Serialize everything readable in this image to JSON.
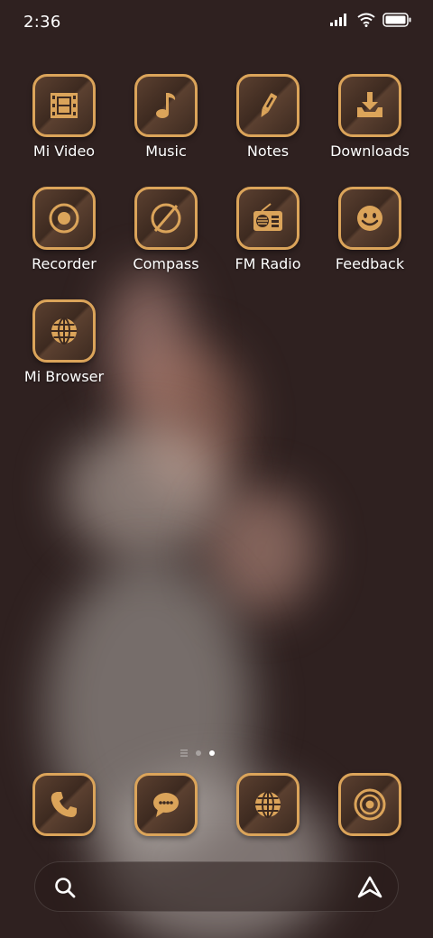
{
  "status_bar": {
    "time": "2:36",
    "icons": [
      "signal-icon",
      "wifi-icon",
      "battery-icon"
    ]
  },
  "home": {
    "apps": [
      {
        "label": "Mi Video",
        "icon": "film-icon"
      },
      {
        "label": "Music",
        "icon": "music-note-icon"
      },
      {
        "label": "Notes",
        "icon": "pen-icon"
      },
      {
        "label": "Downloads",
        "icon": "download-icon"
      },
      {
        "label": "Recorder",
        "icon": "record-icon"
      },
      {
        "label": "Compass",
        "icon": "compass-icon"
      },
      {
        "label": "FM Radio",
        "icon": "radio-icon"
      },
      {
        "label": "Feedback",
        "icon": "smiley-icon"
      },
      {
        "label": "Mi Browser",
        "icon": "globe-icon"
      }
    ],
    "page_indicator": {
      "pages": 2,
      "current": 2,
      "has_feed_page": true
    }
  },
  "dock": {
    "apps": [
      {
        "name": "Phone",
        "icon": "phone-icon"
      },
      {
        "name": "Messages",
        "icon": "chat-icon"
      },
      {
        "name": "Browser",
        "icon": "globe-icon"
      },
      {
        "name": "Camera",
        "icon": "lens-icon"
      }
    ]
  },
  "search_bar": {
    "left_icon": "search-icon",
    "right_icon": "assistant-icon"
  },
  "colors": {
    "background": "#2f2120",
    "accent_gold": "#dba45a",
    "icon_tile_dark": "#3d2a20",
    "text": "#ffffff"
  }
}
